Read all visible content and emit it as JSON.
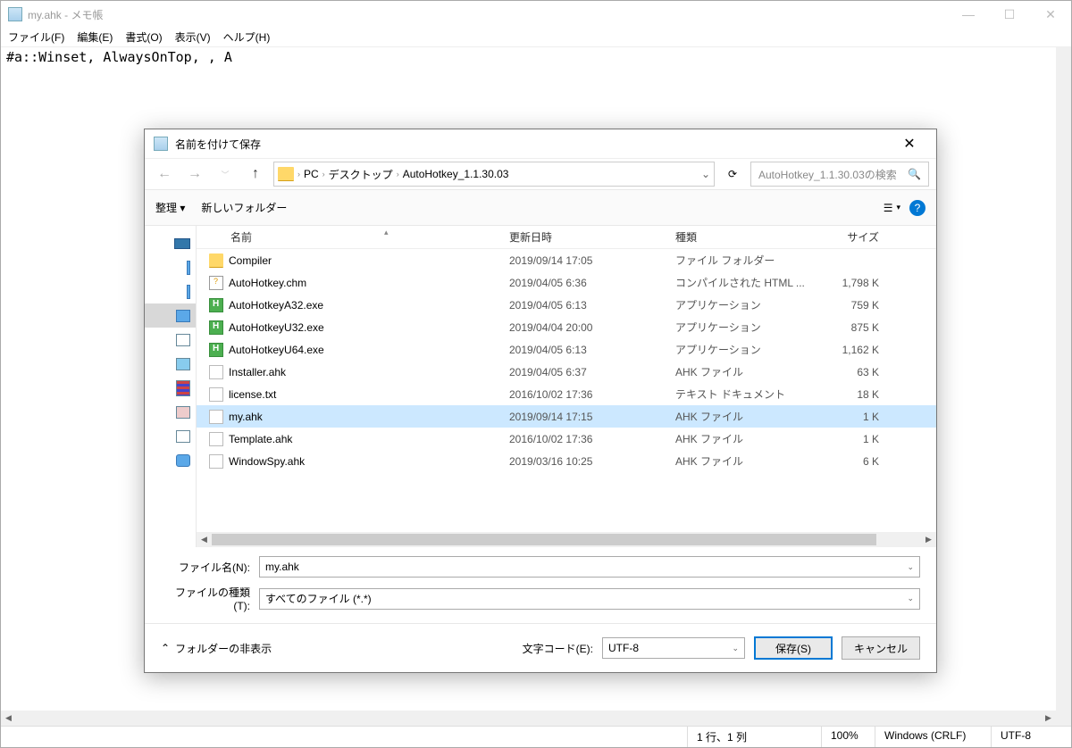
{
  "notepad": {
    "title": "my.ahk - メモ帳",
    "menu": [
      "ファイル(F)",
      "編集(E)",
      "書式(O)",
      "表示(V)",
      "ヘルプ(H)"
    ],
    "content": "#a::Winset, AlwaysOnTop, , A",
    "status": {
      "pos": "1 行、1 列",
      "zoom": "100%",
      "eol": "Windows (CRLF)",
      "enc": "UTF-8"
    }
  },
  "dialog": {
    "title": "名前を付けて保存",
    "breadcrumb": [
      "PC",
      "デスクトップ",
      "AutoHotkey_1.1.30.03"
    ],
    "search_placeholder": "AutoHotkey_1.1.30.03の検索",
    "toolbar": {
      "organize": "整理",
      "new_folder": "新しいフォルダー"
    },
    "columns": {
      "name": "名前",
      "date": "更新日時",
      "type": "種類",
      "size": "サイズ"
    },
    "files": [
      {
        "icon": "folder",
        "name": "Compiler",
        "date": "2019/09/14 17:05",
        "type": "ファイル フォルダー",
        "size": ""
      },
      {
        "icon": "chm",
        "name": "AutoHotkey.chm",
        "date": "2019/04/05 6:36",
        "type": "コンパイルされた HTML ...",
        "size": "1,798 K"
      },
      {
        "icon": "exe",
        "name": "AutoHotkeyA32.exe",
        "date": "2019/04/05 6:13",
        "type": "アプリケーション",
        "size": "759 K"
      },
      {
        "icon": "exe",
        "name": "AutoHotkeyU32.exe",
        "date": "2019/04/04 20:00",
        "type": "アプリケーション",
        "size": "875 K"
      },
      {
        "icon": "exe",
        "name": "AutoHotkeyU64.exe",
        "date": "2019/04/05 6:13",
        "type": "アプリケーション",
        "size": "1,162 K"
      },
      {
        "icon": "file",
        "name": "Installer.ahk",
        "date": "2019/04/05 6:37",
        "type": "AHK ファイル",
        "size": "63 K"
      },
      {
        "icon": "file",
        "name": "license.txt",
        "date": "2016/10/02 17:36",
        "type": "テキスト ドキュメント",
        "size": "18 K"
      },
      {
        "icon": "file",
        "name": "my.ahk",
        "date": "2019/09/14 17:15",
        "type": "AHK ファイル",
        "size": "1 K",
        "selected": true
      },
      {
        "icon": "file",
        "name": "Template.ahk",
        "date": "2016/10/02 17:36",
        "type": "AHK ファイル",
        "size": "1 K"
      },
      {
        "icon": "file",
        "name": "WindowSpy.ahk",
        "date": "2019/03/16 10:25",
        "type": "AHK ファイル",
        "size": "6 K"
      }
    ],
    "filename_label": "ファイル名(N):",
    "filename_value": "my.ahk",
    "filetype_label": "ファイルの種類(T):",
    "filetype_value": "すべてのファイル  (*.*)",
    "hide_folders": "フォルダーの非表示",
    "encoding_label": "文字コード(E):",
    "encoding_value": "UTF-8",
    "save_btn": "保存(S)",
    "cancel_btn": "キャンセル"
  }
}
